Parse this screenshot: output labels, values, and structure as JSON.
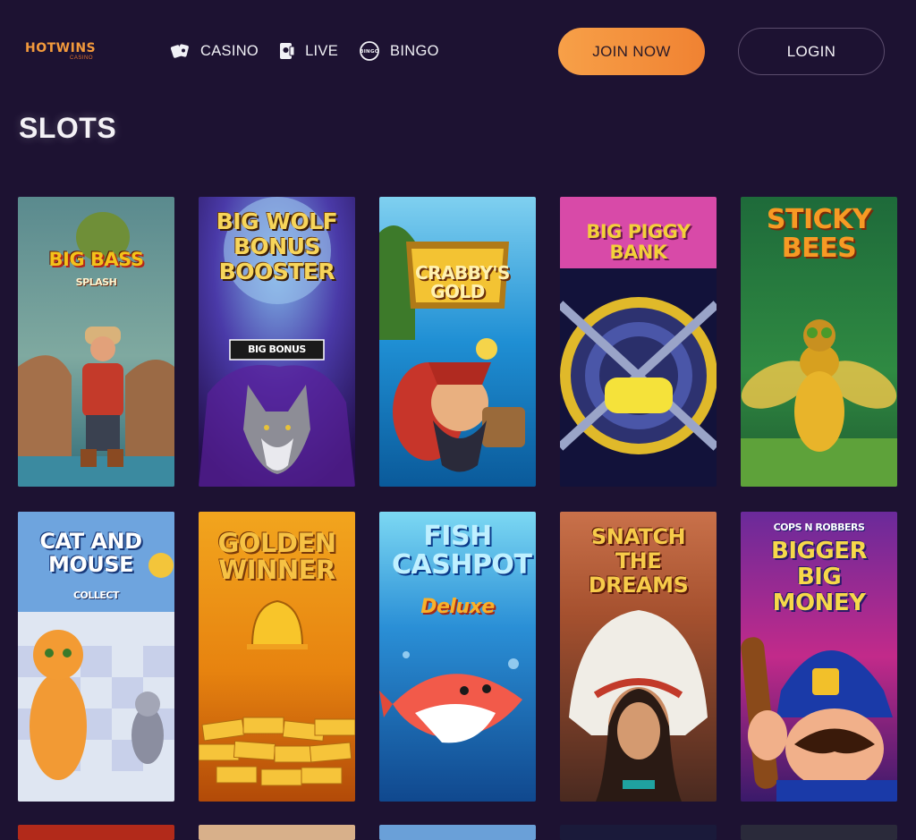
{
  "brand": {
    "name": "HOTWINS",
    "tagline": "CASINO",
    "colors": {
      "background": "#1d1232",
      "accent": "#f39a3c",
      "text": "#f1f1f6"
    }
  },
  "nav": {
    "items": [
      {
        "label": "CASINO",
        "icon": "cards-icon"
      },
      {
        "label": "LIVE",
        "icon": "live-dealer-icon"
      },
      {
        "label": "BINGO",
        "icon": "bingo-ball-icon"
      }
    ]
  },
  "actions": {
    "join": "JOIN NOW",
    "login": "LOGIN"
  },
  "section": {
    "title": "SLOTS"
  },
  "games": [
    {
      "title": "BIG BASS",
      "subtitle": "SPLASH"
    },
    {
      "title": "BIG WOLF BONUS BOOSTER",
      "badge": "BIG BONUS"
    },
    {
      "title": "CRABBY'S GOLD"
    },
    {
      "title": "BIG PIGGY BANK"
    },
    {
      "title": "STICKY BEES"
    },
    {
      "title": "CAT AND MOUSE",
      "subtitle": "COLLECT"
    },
    {
      "title": "GOLDEN WINNER"
    },
    {
      "title": "FISH CASHPOT",
      "subtitle": "Deluxe"
    },
    {
      "title": "SNATCH THE DREAMS"
    },
    {
      "title": "BIGGER BIG MONEY",
      "subtitle": "COPS N ROBBERS"
    }
  ]
}
